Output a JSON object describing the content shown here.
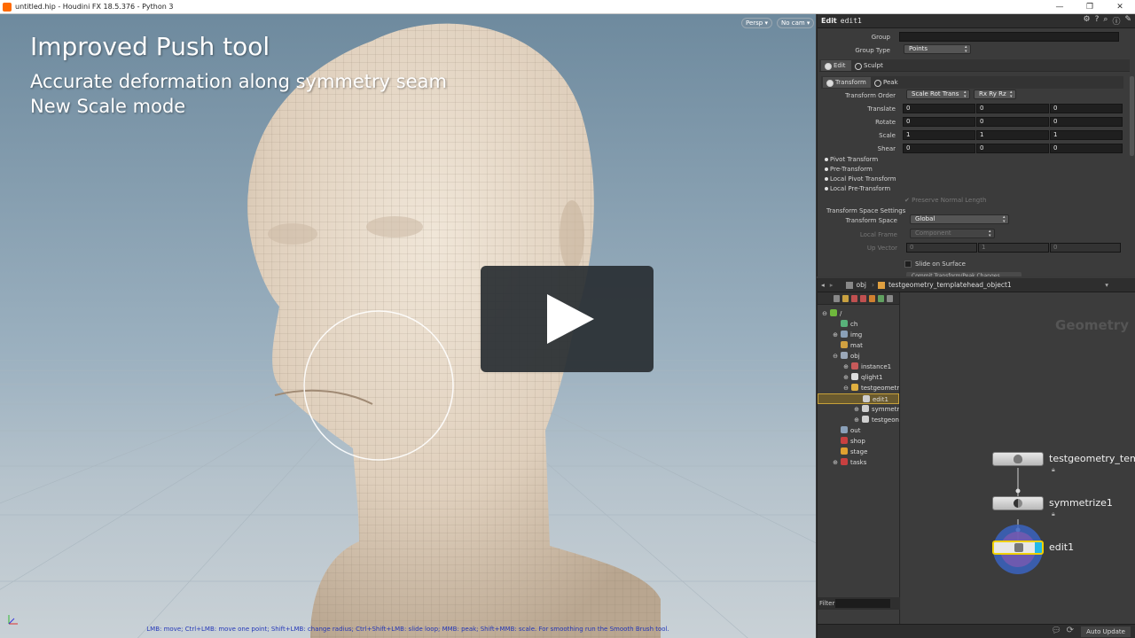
{
  "window": {
    "title": "untitled.hip - Houdini FX 18.5.376 - Python 3",
    "min_glyph": "—",
    "max_glyph": "❐",
    "close_glyph": "✕"
  },
  "viewport": {
    "title": "Improved Push tool",
    "subtitle_line1": "Accurate deformation along symmetry seam",
    "subtitle_line2": "New Scale mode",
    "persp_btn": "Persp ▾",
    "cam_btn": "No cam ▾",
    "status": "LMB: move; Ctrl+LMB: move one point; Shift+LMB: change radius; Ctrl+Shift+LMB: slide loop; MMB: peak; Shift+MMB: scale. For smoothing run the Smooth Brush tool."
  },
  "params": {
    "header_tag": "Edit",
    "node_name": "edit1",
    "group_label": "Group",
    "group_value": "",
    "group_type_label": "Group Type",
    "group_type_value": "Points",
    "tab_edit": "Edit",
    "tab_sculpt": "Sculpt",
    "subtab_transform": "Transform",
    "subtab_peak": "Peak",
    "transform_order_label": "Transform Order",
    "transform_order_value": "Scale Rot Trans",
    "rot_order_value": "Rx Ry Rz",
    "translate_label": "Translate",
    "translate": [
      "0",
      "0",
      "0"
    ],
    "rotate_label": "Rotate",
    "rotate": [
      "0",
      "0",
      "0"
    ],
    "scale_label": "Scale",
    "scale": [
      "1",
      "1",
      "1"
    ],
    "shear_label": "Shear",
    "shear": [
      "0",
      "0",
      "0"
    ],
    "pivot_transform": "Pivot Transform",
    "pre_transform": "Pre-Transform",
    "local_pivot_transform": "Local Pivot Transform",
    "local_pre_transform": "Local Pre-Transform",
    "preserve_normal_length": "Preserve Normal Length",
    "transform_space_settings": "Transform Space Settings",
    "transform_space_label": "Transform Space",
    "transform_space_value": "Global",
    "local_frame_label": "Local Frame",
    "local_frame_value": "Component",
    "up_vector_label": "Up Vector",
    "up_vector": [
      "0",
      "1",
      "0"
    ],
    "slide_on_surface": "Slide on Surface",
    "commit_button": "Commit Transform/Peak Changes"
  },
  "network": {
    "path_obj": "obj",
    "path_node": "testgeometry_templatehead_object1",
    "context_label": "Geometry",
    "tree": [
      {
        "label": "/",
        "depth": 0,
        "expand": "⊖",
        "color": "#6fb83d"
      },
      {
        "label": "ch",
        "depth": 1,
        "expand": "",
        "color": "#58b27a"
      },
      {
        "label": "img",
        "depth": 1,
        "expand": "⊕",
        "color": "#8aa0b8"
      },
      {
        "label": "mat",
        "depth": 1,
        "expand": "",
        "color": "#d0a040"
      },
      {
        "label": "obj",
        "depth": 1,
        "expand": "⊖",
        "color": "#9aa7b8"
      },
      {
        "label": "instance1",
        "depth": 2,
        "expand": "⊕",
        "color": "#c85a5a"
      },
      {
        "label": "qlight1",
        "depth": 2,
        "expand": "⊕",
        "color": "#dddddd"
      },
      {
        "label": "testgeometr",
        "depth": 2,
        "expand": "⊖",
        "color": "#e0b040"
      },
      {
        "label": "edit1",
        "depth": 3,
        "expand": "",
        "color": "#cfcfcf"
      },
      {
        "label": "symmetr",
        "depth": 3,
        "expand": "⊕",
        "color": "#cfcfcf"
      },
      {
        "label": "testgeon",
        "depth": 3,
        "expand": "⊕",
        "color": "#cfcfcf"
      },
      {
        "label": "out",
        "depth": 1,
        "expand": "",
        "color": "#8aa0b8"
      },
      {
        "label": "shop",
        "depth": 1,
        "expand": "",
        "color": "#c84040"
      },
      {
        "label": "stage",
        "depth": 1,
        "expand": "",
        "color": "#e0a030"
      },
      {
        "label": "tasks",
        "depth": 1,
        "expand": "⊕",
        "color": "#c84040"
      }
    ],
    "nodes": [
      "testgeometry_tem",
      "symmetrize1",
      "edit1"
    ],
    "filter_label": "Filter",
    "auto_update": "Auto Update"
  }
}
